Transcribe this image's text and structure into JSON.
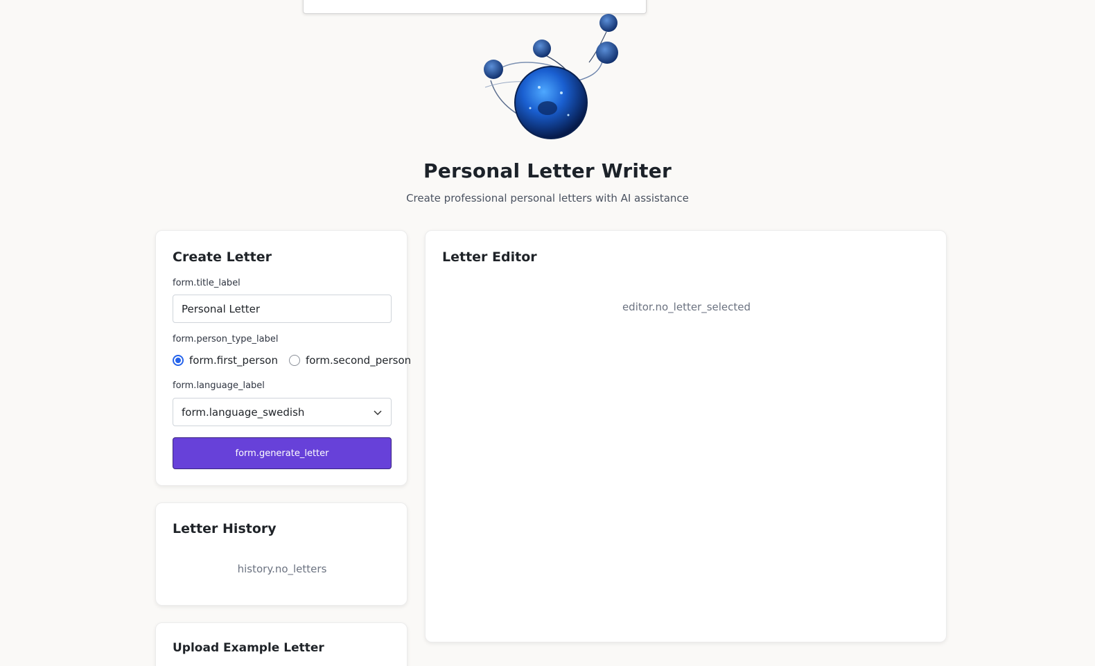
{
  "header": {
    "title": "Personal Letter Writer",
    "subtitle": "Create professional personal letters with AI assistance"
  },
  "create_letter": {
    "heading": "Create Letter",
    "title_label": "form.title_label",
    "title_value": "Personal Letter",
    "person_type_label": "form.person_type_label",
    "first_person": "form.first_person",
    "second_person": "form.second_person",
    "selected_person_type": "form.first_person",
    "language_label": "form.language_label",
    "language_value": "form.language_swedish",
    "generate_button": "form.generate_letter"
  },
  "history": {
    "heading": "Letter History",
    "empty": "history.no_letters"
  },
  "upload": {
    "heading": "Upload Example Letter"
  },
  "editor": {
    "heading": "Letter Editor",
    "empty": "editor.no_letter_selected"
  },
  "icons": {
    "logo": "blue-glass-sphere-logo",
    "select_arrow": "chevron-down-icon"
  },
  "colors": {
    "background": "#faf9f7",
    "primary_button": "#6741d9",
    "radio_selected": "#2563eb"
  }
}
